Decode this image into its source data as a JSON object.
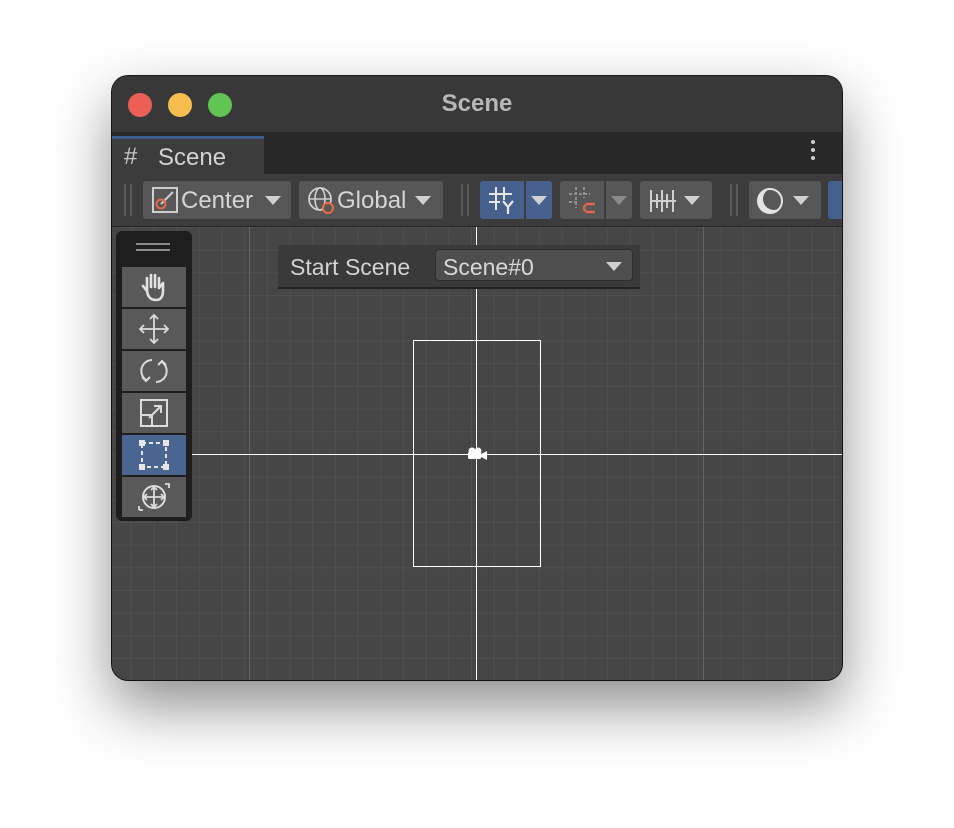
{
  "window": {
    "title": "Scene"
  },
  "tab": {
    "icon": "hash-icon",
    "label": "Scene"
  },
  "toolbar": {
    "pivot_label": "Center",
    "pivot_icon": "pivot-center-icon",
    "rotation_label": "Global",
    "rotation_icon": "globe-icon",
    "grid_snap_icon": "grid-visibility-icon",
    "snap_increment_icon": "grid-snap-magnet-icon",
    "increment_icon": "increment-snap-icon",
    "view_options_icon": "shading-mode-icon"
  },
  "tools": [
    {
      "name": "hand-tool",
      "icon": "hand-icon",
      "selected": false
    },
    {
      "name": "move-tool",
      "icon": "move-arrows-icon",
      "selected": false
    },
    {
      "name": "rotate-tool",
      "icon": "rotate-icon",
      "selected": false
    },
    {
      "name": "scale-tool",
      "icon": "scale-icon",
      "selected": false
    },
    {
      "name": "rect-tool",
      "icon": "rect-transform-icon",
      "selected": true
    },
    {
      "name": "transform-tool",
      "icon": "transform-gizmo-icon",
      "selected": false
    }
  ],
  "start_scene": {
    "label": "Start Scene",
    "value": "Scene#0"
  },
  "colors": {
    "accent": "#47618e",
    "viewport_bg": "#464646",
    "traffic_red": "#ec5f57",
    "traffic_yellow": "#f5be4f",
    "traffic_green": "#61c554"
  }
}
